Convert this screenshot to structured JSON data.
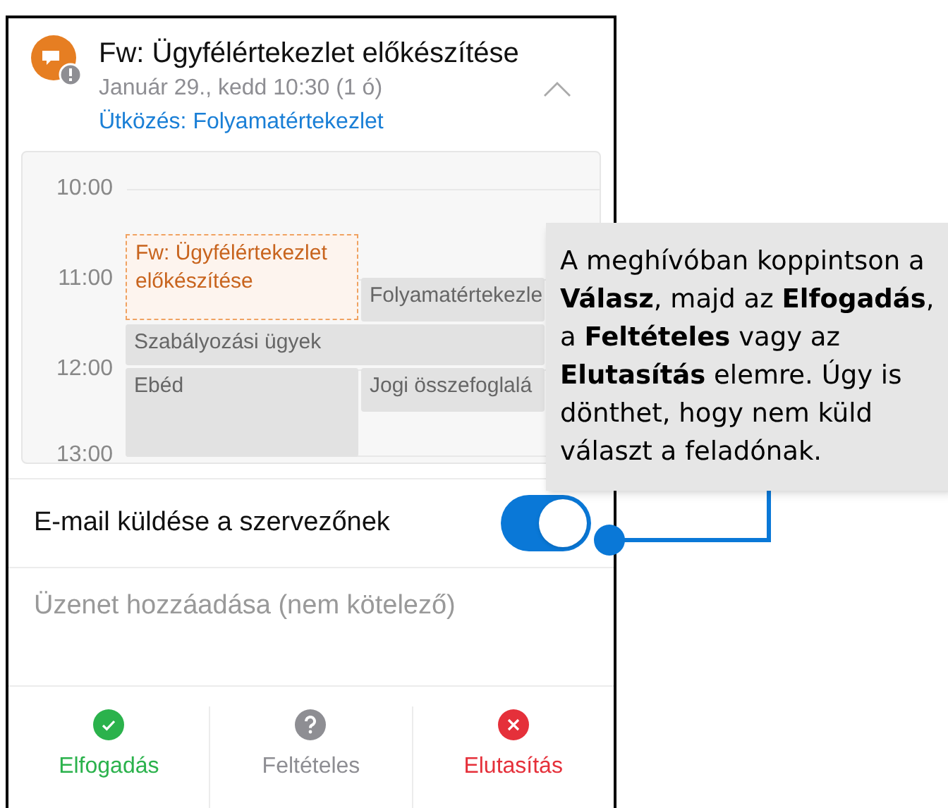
{
  "meeting": {
    "title": "Fw: Ügyfélértekezlet előkészítése",
    "when": "Január 29., kedd 10:30 (1 ó)",
    "conflict": "Ütközés: Folyamatértekezlet",
    "expanded": true
  },
  "calendar": {
    "hours": [
      "10:00",
      "11:00",
      "12:00",
      "13:00"
    ],
    "events": [
      {
        "title": "Fw: Ügyfélértekezlet előkészítése",
        "kind": "current"
      },
      {
        "title": "Folyamatértekezle",
        "kind": "busy"
      },
      {
        "title": "Szabályozási ügyek",
        "kind": "busy"
      },
      {
        "title": "Ebéd",
        "kind": "busy"
      },
      {
        "title": "Jogi összefoglalá",
        "kind": "busy"
      }
    ]
  },
  "send_email": {
    "label": "E-mail küldése a szervezőnek",
    "on": true
  },
  "message": {
    "placeholder": "Üzenet hozzáadása (nem kötelező)"
  },
  "responses": [
    {
      "label": "Elfogadás",
      "kind": "accept"
    },
    {
      "label": "Feltételes",
      "kind": "tentative"
    },
    {
      "label": "Elutasítás",
      "kind": "decline"
    }
  ],
  "callout": {
    "text": "A meghívóban koppintson a **Válasz**, majd az **Elfogadás**, a **Feltételes** vagy az **Elutasítás** elemre. Úgy is dönthet, hogy nem küld választ a feladónak."
  }
}
